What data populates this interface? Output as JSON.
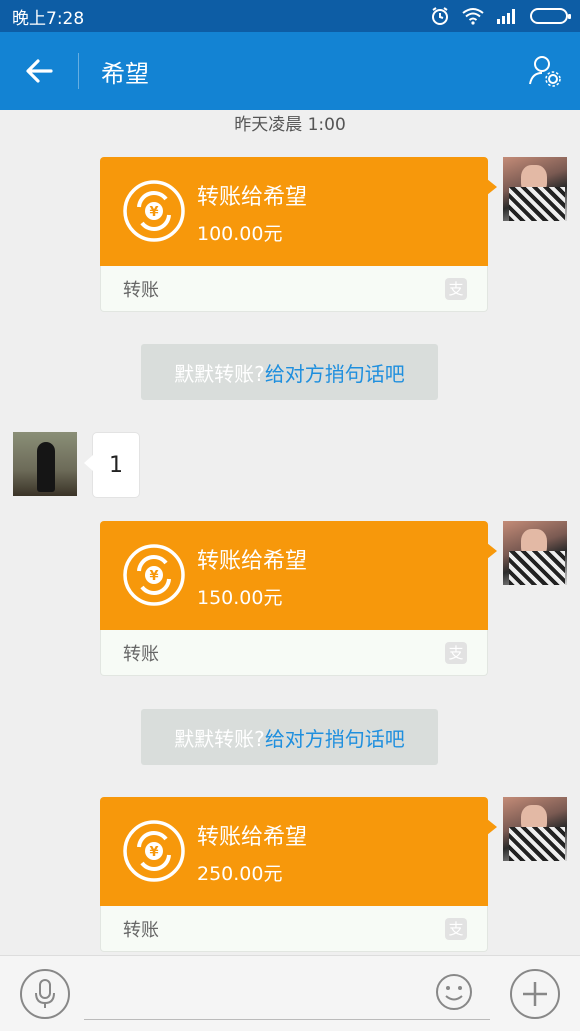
{
  "status_bar": {
    "time": "晚上7:28"
  },
  "header": {
    "title": "希望"
  },
  "timestamp": "昨天凌晨 1:00",
  "messages": [
    {
      "type": "transfer",
      "title": "转账给希望",
      "amount": "100.00元",
      "label": "转账"
    },
    {
      "type": "note",
      "muted": "默默转账?",
      "link": "给对方捎句话吧"
    },
    {
      "type": "text",
      "text": "1"
    },
    {
      "type": "transfer",
      "title": "转账给希望",
      "amount": "150.00元",
      "label": "转账"
    },
    {
      "type": "note",
      "muted": "默默转账?",
      "link": "给对方捎句话吧"
    },
    {
      "type": "transfer",
      "title": "转账给希望",
      "amount": "250.00元",
      "label": "转账"
    }
  ],
  "icons": {
    "alipay": "支"
  },
  "colors": {
    "header_bg": "#1383d3",
    "status_bg": "#0d5da5",
    "transfer_orange": "#f7980b",
    "link_blue": "#1f8fde"
  }
}
